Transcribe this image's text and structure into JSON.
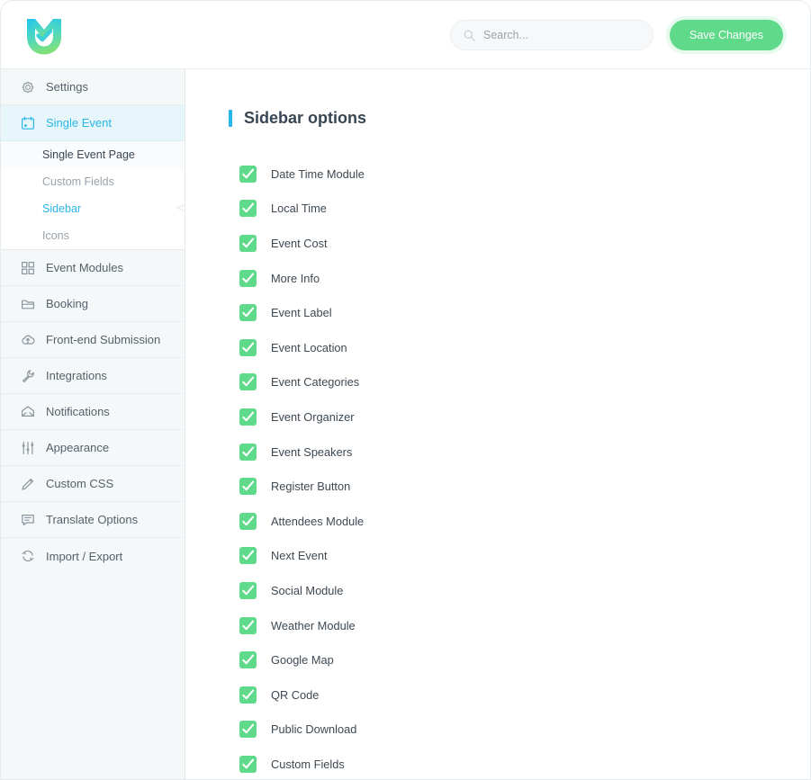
{
  "header": {
    "logo_name": "shield-check-logo",
    "search": {
      "placeholder": "Search...",
      "value": ""
    },
    "save_label": "Save Changes"
  },
  "sidebar": {
    "items": [
      {
        "label": "Settings",
        "icon": "gear-icon",
        "state": "normal"
      },
      {
        "label": "Single Event",
        "icon": "calendar-icon",
        "state": "active"
      }
    ],
    "subitems": [
      {
        "label": "Single Event Page",
        "state": "current"
      },
      {
        "label": "Custom Fields",
        "state": "normal"
      },
      {
        "label": "Sidebar",
        "state": "selected"
      },
      {
        "label": "Icons",
        "state": "normal"
      }
    ],
    "items_after": [
      {
        "label": "Event Modules",
        "icon": "grid-icon"
      },
      {
        "label": "Booking",
        "icon": "folder-icon"
      },
      {
        "label": "Front-end Submission",
        "icon": "cloud-upload-icon"
      },
      {
        "label": "Integrations",
        "icon": "wrench-icon"
      },
      {
        "label": "Notifications",
        "icon": "envelope-icon"
      },
      {
        "label": "Appearance",
        "icon": "sliders-icon"
      },
      {
        "label": "Custom CSS",
        "icon": "pencil-icon"
      },
      {
        "label": "Translate Options",
        "icon": "comment-icon"
      },
      {
        "label": "Import / Export",
        "icon": "sync-icon"
      }
    ]
  },
  "main": {
    "title": "Sidebar options",
    "options": [
      {
        "label": "Date Time Module",
        "checked": true
      },
      {
        "label": "Local Time",
        "checked": true
      },
      {
        "label": "Event Cost",
        "checked": true
      },
      {
        "label": "More Info",
        "checked": true
      },
      {
        "label": "Event Label",
        "checked": true
      },
      {
        "label": "Event Location",
        "checked": true
      },
      {
        "label": "Event Categories",
        "checked": true
      },
      {
        "label": "Event Organizer",
        "checked": true
      },
      {
        "label": "Event Speakers",
        "checked": true
      },
      {
        "label": "Register Button",
        "checked": true
      },
      {
        "label": "Attendees Module",
        "checked": true
      },
      {
        "label": "Next Event",
        "checked": true
      },
      {
        "label": "Social Module",
        "checked": true
      },
      {
        "label": "Weather Module",
        "checked": true
      },
      {
        "label": "Google Map",
        "checked": true
      },
      {
        "label": "QR Code",
        "checked": true
      },
      {
        "label": "Public Download",
        "checked": true
      },
      {
        "label": "Custom Fields",
        "checked": true
      }
    ]
  },
  "colors": {
    "accent": "#29b6e8",
    "checkbox_green": "#5fd98a",
    "save_green": "#5fd98a",
    "text_dark": "#3d4852",
    "nav_bg": "#f5f8f9"
  }
}
